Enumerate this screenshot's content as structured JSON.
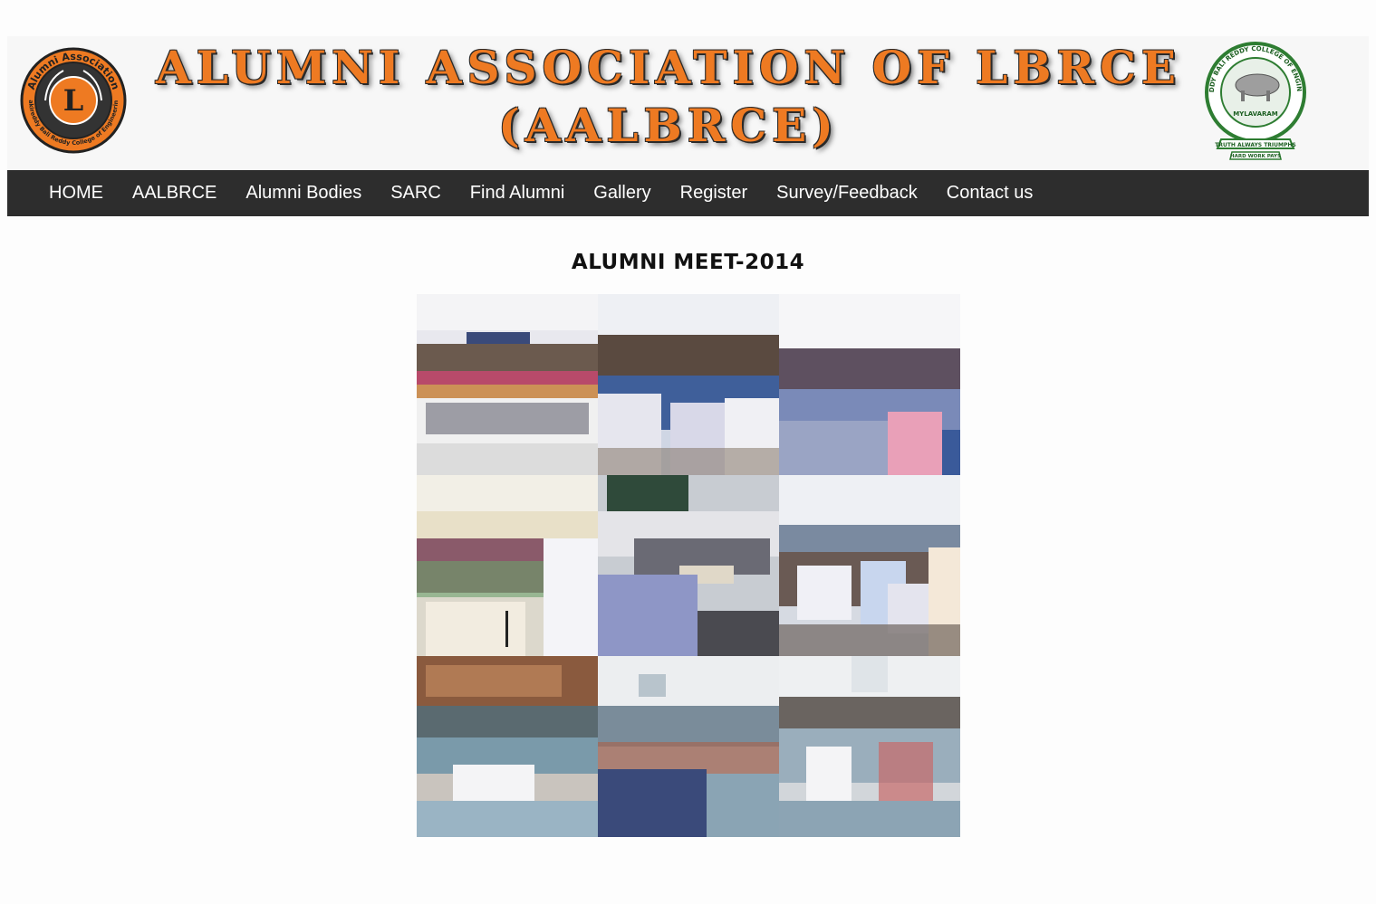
{
  "header": {
    "title_line1": "ALUMNI ASSOCIATION OF LBRCE",
    "title_line2": "(AALBRCE)",
    "left_logo": {
      "ring_text": "Alumni Association",
      "letter": "L",
      "bottom_text": "Lakireddy Bali Reddy College of Engineering"
    },
    "right_logo": {
      "ring_text": "LAKIREDDY BALI REDDY COLLEGE OF ENGINEERING",
      "place": "MYLAVARAM",
      "motto": "TRUTH ALWAYS TRIUMPHS",
      "ribbon": "HARD WORK PAYS"
    }
  },
  "nav": {
    "items": [
      {
        "label": "HOME"
      },
      {
        "label": "AALBRCE"
      },
      {
        "label": "Alumni Bodies"
      },
      {
        "label": "SARC"
      },
      {
        "label": "Find Alumni"
      },
      {
        "label": "Gallery"
      },
      {
        "label": "Register"
      },
      {
        "label": "Survey/Feedback"
      },
      {
        "label": "Contact us"
      }
    ]
  },
  "main": {
    "heading": "ALUMNI MEET-2014"
  },
  "gallery": {
    "photos": [
      {
        "name": "group-photo"
      },
      {
        "name": "audience-front-rows"
      },
      {
        "name": "audience-hall"
      },
      {
        "name": "speaker-podium"
      },
      {
        "name": "meeting-table"
      },
      {
        "name": "seated-alumni"
      },
      {
        "name": "classroom-1"
      },
      {
        "name": "classroom-2"
      },
      {
        "name": "classroom-3"
      }
    ]
  },
  "colors": {
    "accent_orange": "#ee7a22",
    "nav_bg": "#2d2d2d",
    "nav_text": "#ffffff",
    "logo_green": "#2e7d32"
  }
}
